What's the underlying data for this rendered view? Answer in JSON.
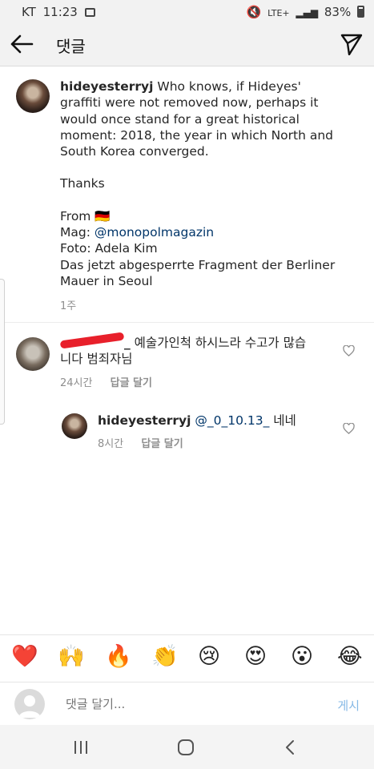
{
  "status_bar": {
    "carrier": "KT",
    "time": "11:23",
    "battery": "83%",
    "network": "LTE+"
  },
  "header": {
    "title": "댓글"
  },
  "caption": {
    "username": "hideyesterryj",
    "text_line1": " Who knows, if Hideyes' graffiti were not removed now, perhaps it would once stand for a great historical moment: 2018, the year in which North and South Korea converged.",
    "thanks": "Thanks",
    "from": "From 🇩🇪",
    "mag_label": "Mag: ",
    "mag_handle": "@monopolmagazin",
    "foto": "Foto: Adela Kim",
    "fragment": "Das jetzt abgesperrte Fragment der Berliner Mauer in Seoul",
    "time": "1주"
  },
  "comment": {
    "username_suffix": "_",
    "text": " 예술가인척 하시느라 수고가 많습니다 범죄자님",
    "time": "24시간",
    "reply_label": "답글 달기"
  },
  "reply": {
    "username": "hideyesterryj",
    "mention": "@_0_10.13_",
    "text": " 네네",
    "time": "8시간",
    "reply_label": "답글 달기"
  },
  "emoji_bar": [
    "❤️",
    "🙌",
    "🔥",
    "👏",
    "😢",
    "😍",
    "😮",
    "😂"
  ],
  "input": {
    "placeholder": "댓글 달기...",
    "post_label": "게시"
  },
  "colors": {
    "link": "#003569",
    "post_disabled": "#86b9e6",
    "redaction": "#e8202b"
  }
}
